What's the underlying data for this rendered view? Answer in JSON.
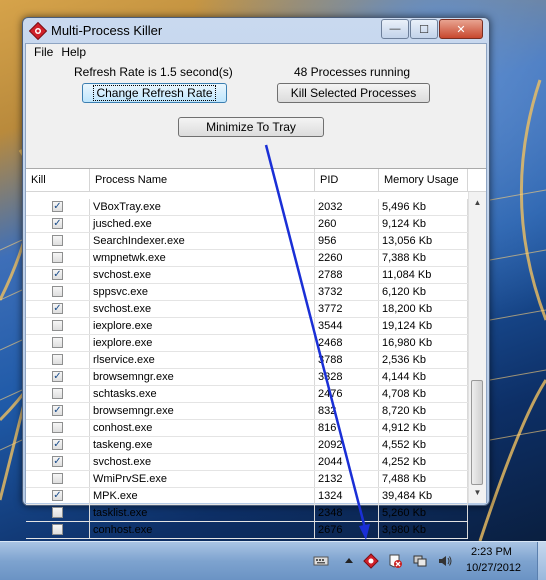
{
  "window": {
    "title": "Multi-Process Killer",
    "minimize_glyph": "—",
    "maximize_glyph": "☐",
    "close_glyph": "✕"
  },
  "menu": {
    "items": [
      "File",
      "Help"
    ]
  },
  "status": {
    "refresh_rate": "Refresh Rate is 1.5 second(s)",
    "process_count": "48 Processes running"
  },
  "buttons": {
    "change_refresh": "Change Refresh Rate",
    "kill_selected": "Kill Selected Processes",
    "minimize_tray": "Minimize To Tray"
  },
  "table": {
    "headers": [
      "Kill",
      "Process Name",
      "PID",
      "Memory Usage"
    ],
    "rows": [
      {
        "kill": true,
        "name": "VBoxTray.exe",
        "pid": "2032",
        "mem": "5,496 Kb"
      },
      {
        "kill": true,
        "name": "jusched.exe",
        "pid": "260",
        "mem": "9,124 Kb"
      },
      {
        "kill": false,
        "name": "SearchIndexer.exe",
        "pid": "956",
        "mem": "13,056 Kb"
      },
      {
        "kill": false,
        "name": "wmpnetwk.exe",
        "pid": "2260",
        "mem": "7,388 Kb"
      },
      {
        "kill": true,
        "name": "svchost.exe",
        "pid": "2788",
        "mem": "11,084 Kb"
      },
      {
        "kill": false,
        "name": "sppsvc.exe",
        "pid": "3732",
        "mem": "6,120 Kb"
      },
      {
        "kill": true,
        "name": "svchost.exe",
        "pid": "3772",
        "mem": "18,200 Kb"
      },
      {
        "kill": false,
        "name": "iexplore.exe",
        "pid": "3544",
        "mem": "19,124 Kb"
      },
      {
        "kill": false,
        "name": "iexplore.exe",
        "pid": "2468",
        "mem": "16,980 Kb"
      },
      {
        "kill": false,
        "name": "rlservice.exe",
        "pid": "3788",
        "mem": "2,536 Kb"
      },
      {
        "kill": true,
        "name": "browsemngr.exe",
        "pid": "3328",
        "mem": "4,144 Kb"
      },
      {
        "kill": false,
        "name": "schtasks.exe",
        "pid": "2476",
        "mem": "4,708 Kb"
      },
      {
        "kill": true,
        "name": "browsemngr.exe",
        "pid": "832",
        "mem": "8,720 Kb"
      },
      {
        "kill": false,
        "name": "conhost.exe",
        "pid": "816",
        "mem": "4,912 Kb"
      },
      {
        "kill": true,
        "name": "taskeng.exe",
        "pid": "2092",
        "mem": "4,552 Kb"
      },
      {
        "kill": true,
        "name": "svchost.exe",
        "pid": "2044",
        "mem": "4,252 Kb"
      },
      {
        "kill": false,
        "name": "WmiPrvSE.exe",
        "pid": "2132",
        "mem": "7,488 Kb"
      },
      {
        "kill": true,
        "name": "MPK.exe",
        "pid": "1324",
        "mem": "39,484 Kb"
      },
      {
        "kill": false,
        "name": "tasklist.exe",
        "pid": "2348",
        "mem": "5,260 Kb"
      },
      {
        "kill": false,
        "name": "conhost.exe",
        "pid": "2676",
        "mem": "3,980 Kb"
      }
    ]
  },
  "taskbar": {
    "time": "2:23 PM",
    "date": "10/27/2012"
  },
  "colors": {
    "arrow": "#1a2fd6",
    "app_icon": "#d0202a"
  }
}
